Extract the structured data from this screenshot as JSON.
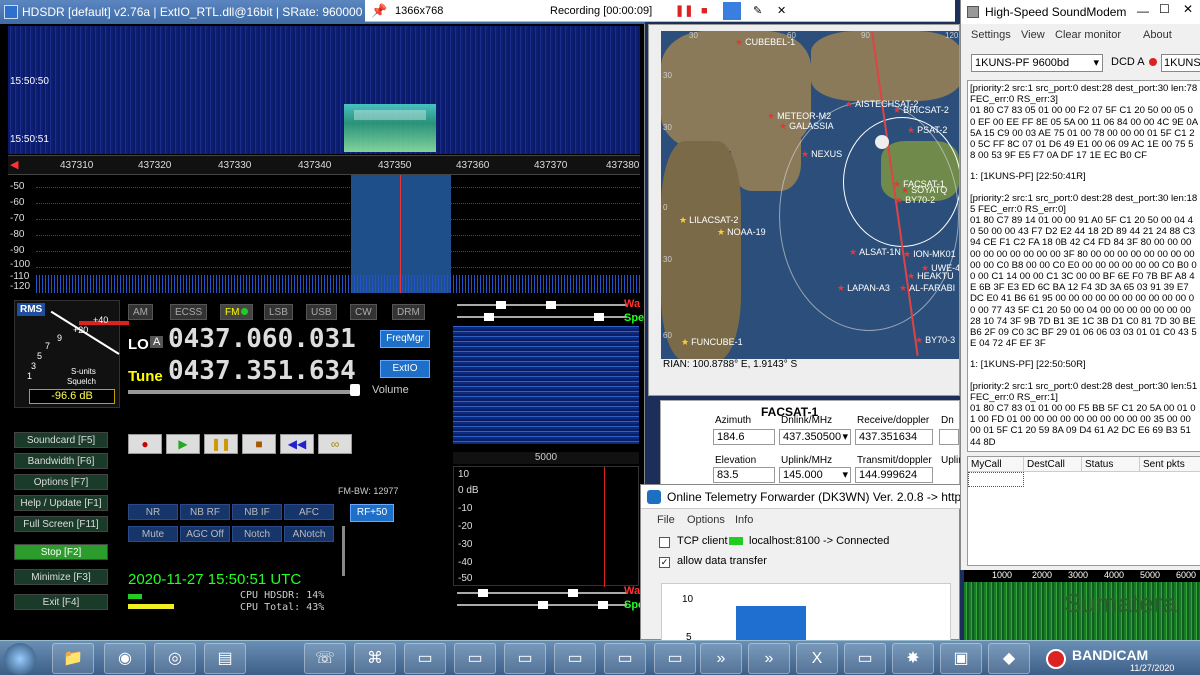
{
  "hdsdr": {
    "title": "HDSDR  [default]  v2.76a  |  ExtIO_RTL.dll@16bit  |  SRate: 960000 > 48000  |  C",
    "wf_times": [
      "15:50:50",
      "15:50:51"
    ],
    "freq_ticks": [
      "437310",
      "437320",
      "437330",
      "437340",
      "437350",
      "437360",
      "437370",
      "437380"
    ],
    "db_ticks": [
      "-50",
      "-60",
      "-70",
      "-80",
      "-90",
      "-100",
      "-110",
      "-120"
    ],
    "rms": "RMS",
    "smeter_scale": [
      "+40",
      "+20",
      "9",
      "7",
      "5",
      "3",
      "1"
    ],
    "smeter_label1": "S-units",
    "smeter_label2": "Squelch",
    "smeter_db": "-96.6 dB",
    "modes": [
      "AM",
      "ECSS",
      "FM",
      "LSB",
      "USB",
      "CW",
      "DRM"
    ],
    "active_mode": "FM",
    "lo_label": "LO",
    "lo_a": "A",
    "lo_value": "0437.060.031",
    "tune_label": "Tune",
    "tune_value": "0437.351.634",
    "freqmgr": "FreqMgr",
    "extio": "ExtIO",
    "volume": "Volume",
    "left_buttons": [
      "Soundcard [F5]",
      "Bandwidth [F6]",
      "Options    [F7]",
      "Help / Update [F1]",
      "Full Screen [F11]",
      "Stop    [F2]",
      "Minimize [F3]",
      "Exit     [F4]"
    ],
    "dsp_row1": [
      "NR",
      "NB RF",
      "NB IF",
      "AFC"
    ],
    "dsp_row2": [
      "Mute",
      "AGC Off",
      "Notch",
      "ANotch"
    ],
    "fm_bw": "FM-BW: 12977",
    "rf50": "RF+50",
    "clock": "2020-11-27   15:50:51 UTC",
    "cpu_hdsdr": "CPU HDSDR: 14%",
    "cpu_total": "CPU Total: 43%",
    "side_scale": "5000",
    "side_db": [
      "10",
      "0 dB",
      "-10",
      "-20",
      "-30",
      "-40",
      "-50"
    ],
    "wa": "Wa",
    "sp": "Spe"
  },
  "bandicam": {
    "resolution": "1366x768",
    "recording": "Recording [00:00:09]"
  },
  "map": {
    "lat_labels": [
      "30",
      "60",
      "90",
      "120",
      "30",
      "30",
      "0",
      "30",
      "60"
    ],
    "satellites": [
      {
        "name": "CUBEBEL-1",
        "yellow": false
      },
      {
        "name": "METEOR-M2",
        "yellow": false
      },
      {
        "name": "GALASSIA",
        "yellow": false
      },
      {
        "name": "AISTECHSAT-2",
        "yellow": false
      },
      {
        "name": "BRICSAT-2",
        "yellow": false
      },
      {
        "name": "PSAT-2",
        "yellow": false
      },
      {
        "name": "NEXUS",
        "yellow": false
      },
      {
        "name": "FACSAT-1",
        "yellow": false
      },
      {
        "name": "SOYATQ",
        "yellow": false
      },
      {
        "name": "BY70-2",
        "yellow": false
      },
      {
        "name": "LILACSAT-2",
        "yellow": true
      },
      {
        "name": "NOAA-19",
        "yellow": true
      },
      {
        "name": "ALSAT-1N",
        "yellow": false
      },
      {
        "name": "ION-MK01",
        "yellow": false
      },
      {
        "name": "UWE-4",
        "yellow": false
      },
      {
        "name": "HEAKTU",
        "yellow": false
      },
      {
        "name": "LAPAN-A3",
        "yellow": false
      },
      {
        "name": "AL-FARABI",
        "yellow": false
      },
      {
        "name": "FUNCUBE-1",
        "yellow": true
      },
      {
        "name": "BY70-3",
        "yellow": false
      }
    ],
    "coord": "RIAN: 100.8788° E, 1.9143° S"
  },
  "facsat": {
    "name": "FACSAT-1",
    "azimuth_label": "Azimuth",
    "azimuth": "184.6",
    "dnlink_label": "Dnlink/MHz",
    "dnlink": "437.350500",
    "rx_label": "Receive/doppler",
    "rx": "437.351634",
    "dn_label": "Dn",
    "elev_label": "Elevation",
    "elev": "83.5",
    "uplink_label": "Uplink/MHz",
    "uplink": "145.000",
    "tx_label": "Transmit/doppler",
    "tx": "144.999624",
    "up_label": "Uplin"
  },
  "forwarder": {
    "title": "Online Telemetry Forwarder (DK3WN) Ver. 2.0.8 -> https://db",
    "menu": [
      "File",
      "Options",
      "Info"
    ],
    "tcp_client": "TCP client",
    "localhost": "localhost:8100 -> Connected",
    "allow": "allow data transfer",
    "chart_ticks": [
      "10",
      "5"
    ]
  },
  "soundmodem": {
    "title": "High-Speed SoundModem",
    "menu": [
      "Settings",
      "View",
      "Clear monitor",
      "About"
    ],
    "combo": "1KUNS-PF 9600bd",
    "dcd": "DCD A",
    "combo2": "1KUNS-PF",
    "monitor": [
      "[priority:2 src:1 src_port:0 dest:28 dest_port:30 len:78 FEC_err:0 RS_err:3]",
      "01 80 C7 83 05 01 00 00 F2 07 5F C1 20 50 00 05 00 EF 00 EE FF 8E 05 5A 00 11 06 84 00 00 4C 9E 0A 5A 15 C9 00 03 AE 75 01 00 78 00 00 00 01 5F C1 20 5C FF 8C 07 01 D6 49 E1 00 06 09 AC 1E 00 75 58 00 53 9F E5 F7 0A DF 17 1E EC B0 CF",
      "1: [1KUNS-PF] [22:50:41R]",
      "[priority:2 src:1 src_port:0 dest:28 dest_port:30 len:185 FEC_err:0 RS_err:0]",
      "01 80 C7 89 14 01 00 00 91 A0 5F C1 20 50 00 04 40 50 00 00 43 F7 D2 E2 44 18 2D 89 44 21 24 88 C3 94 CE F1 C2 FA 18 0B 42 C4 FD 84 3F 80 00 00 00 00 00 00 00 00 00 00 3F 80 00 00 00 00 00 00 00 00 00 00 C0 B8 00 00 C0 E0 00 00 00 00 00 00 C0 B0 00 00 C1 14 00 00 C1 3C 00 00 BF 6E F0 7B BF A8 4E 6B 3F E3 ED 6C BA 12 F4 3D 3A 65 03 91 39 E7 DC E0 41 B6 61 95 00 00 00 00 00 00 00 00 00 00 00 00 77 43 5F C1 20 50 00 04 00 00 00 00 00 00 00 28 10 74 3F 9B 7D B1 3E 1C 3B D1 C0 81 7D 30 BE B6 2F 09 C0 3C BF 29 01 06 06 03 03 01 01 C0 43 5E 04 72 4F EF 3F",
      "1: [1KUNS-PF] [22:50:50R]",
      "[priority:2 src:1 src_port:0 dest:28 dest_port:30 len:51 FEC_err:0 RS_err:1]",
      "01 80 C7 83 01 01 00 00 F5 BB 5F C1 20 5A 00 01 01 00 FD 01 00 00 00 00 00 00 00 00 00 00 35 00 00 00 01 5F C1 20 59 8A 09 D4 61 A2 DC E6 69 B3 51 44 8D"
    ],
    "table_headers": [
      "MyCall",
      "DestCall",
      "Status",
      "Sent pkts"
    ],
    "wf_scale": [
      "1000",
      "2000",
      "3000",
      "4000",
      "5000",
      "6000"
    ],
    "overlay_text": "Sumatera"
  },
  "taskbar": {
    "bandicam": "BANDICAM",
    "date": "11/27/2020"
  }
}
